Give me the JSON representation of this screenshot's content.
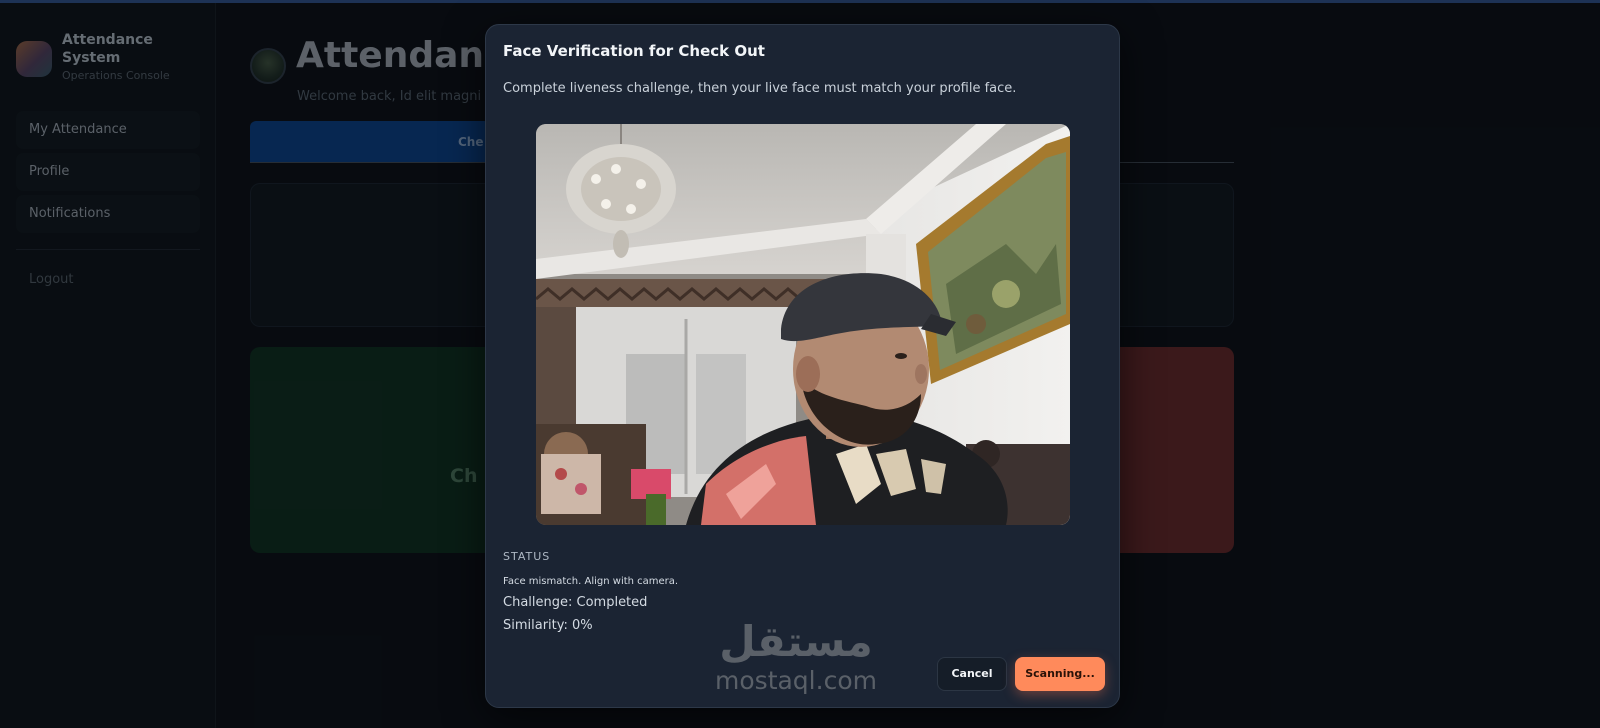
{
  "sidebar": {
    "brand_title": "Attendance System",
    "brand_subtitle": "Operations Console",
    "items": [
      {
        "label": "My Attendance"
      },
      {
        "label": "Profile"
      },
      {
        "label": "Notifications"
      }
    ],
    "logout_label": "Logout"
  },
  "main": {
    "title": "Attendanc",
    "welcome": "Welcome back, Id elit magni c",
    "active_tab_label": "Che",
    "checkin_label": "Ch"
  },
  "modal": {
    "title": "Face Verification for Check Out",
    "description": "Complete liveness challenge, then your live face must match your profile face.",
    "status_label": "STATUS",
    "status_message": "Face mismatch. Align with camera.",
    "challenge": "Challenge: Completed",
    "similarity": "Similarity: 0%",
    "cancel_label": "Cancel",
    "scan_label": "Scanning..."
  },
  "watermark": {
    "arabic": "مستقل",
    "latin": "mostaql.com"
  },
  "colors": {
    "accent_orange": "#ff8a5b",
    "modal_bg": "#1b2433",
    "checkin_green": "#0d2a1d",
    "checkout_red": "#5a2426",
    "tab_blue": "#0a3a78"
  }
}
